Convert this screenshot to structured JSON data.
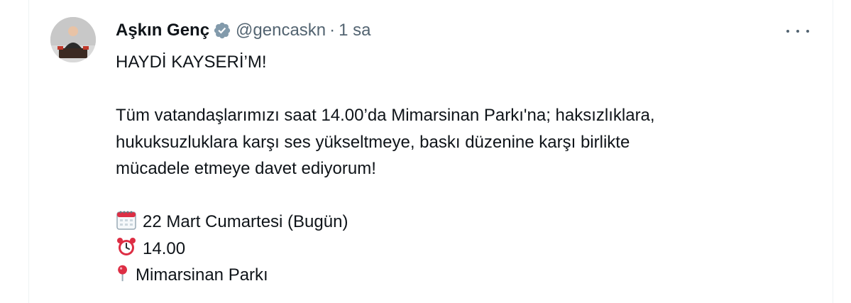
{
  "tweet": {
    "author": {
      "display_name": "Aşkın Genç",
      "handle": "@gencaskn",
      "separator": "·",
      "time": "1 sa"
    },
    "icons": {
      "verified": "verified-badge-icon",
      "more": "more-options-icon",
      "calendar": "calendar-emoji-icon",
      "alarm": "alarm-clock-emoji-icon",
      "pin": "round-pushpin-emoji-icon"
    },
    "text": {
      "headline": "HAYDİ KAYSERİ’M!",
      "paragraph_lines": [
        "Tüm vatandaşlarımızı saat 14.00’da Mimarsinan Parkı'na; haksızlıklara,",
        "hukuksuzluklara karşı ses yükseltmeye, baskı düzenine karşı birlikte",
        "mücadele etmeye davet ediyorum!"
      ],
      "date": "22 Mart Cumartesi (Bugün)",
      "hour": "14.00",
      "place": "Mimarsinan Parkı"
    },
    "colors": {
      "text": "#0f1419",
      "secondary": "#536471",
      "border": "#eff3f4",
      "verified": "#829aab"
    }
  }
}
